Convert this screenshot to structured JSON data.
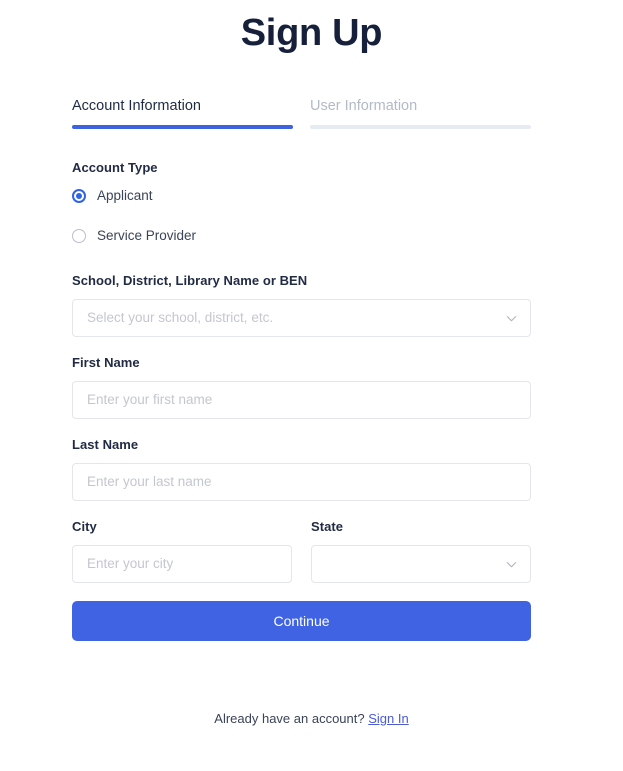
{
  "page": {
    "title": "Sign Up"
  },
  "tabs": [
    {
      "label": "Account Information",
      "state": "active"
    },
    {
      "label": "User Information",
      "state": "inactive"
    }
  ],
  "form": {
    "account_type": {
      "label": "Account Type",
      "options": [
        {
          "label": "Applicant",
          "selected": true
        },
        {
          "label": "Service Provider",
          "selected": false
        }
      ]
    },
    "school": {
      "label": "School, District, Library Name or BEN",
      "placeholder": "Select your school, district, etc.",
      "value": ""
    },
    "first_name": {
      "label": "First Name",
      "placeholder": "Enter your first name",
      "value": ""
    },
    "last_name": {
      "label": "Last Name",
      "placeholder": "Enter your last name",
      "value": ""
    },
    "city": {
      "label": "City",
      "placeholder": "Enter your city",
      "value": ""
    },
    "state": {
      "label": "State",
      "placeholder": "",
      "value": ""
    },
    "submit_label": "Continue"
  },
  "footer": {
    "text": "Already have an account?",
    "link_label": "Sign In"
  },
  "colors": {
    "accent": "#4063e3",
    "tab_active_underline": "#3f63e0",
    "tab_inactive_underline": "#e6eaf2",
    "radio_selected": "#2f63e8",
    "link": "#4a5bd4",
    "input_border": "#e3e6ed",
    "placeholder": "#c3c7ce",
    "background": "#ffffff"
  }
}
